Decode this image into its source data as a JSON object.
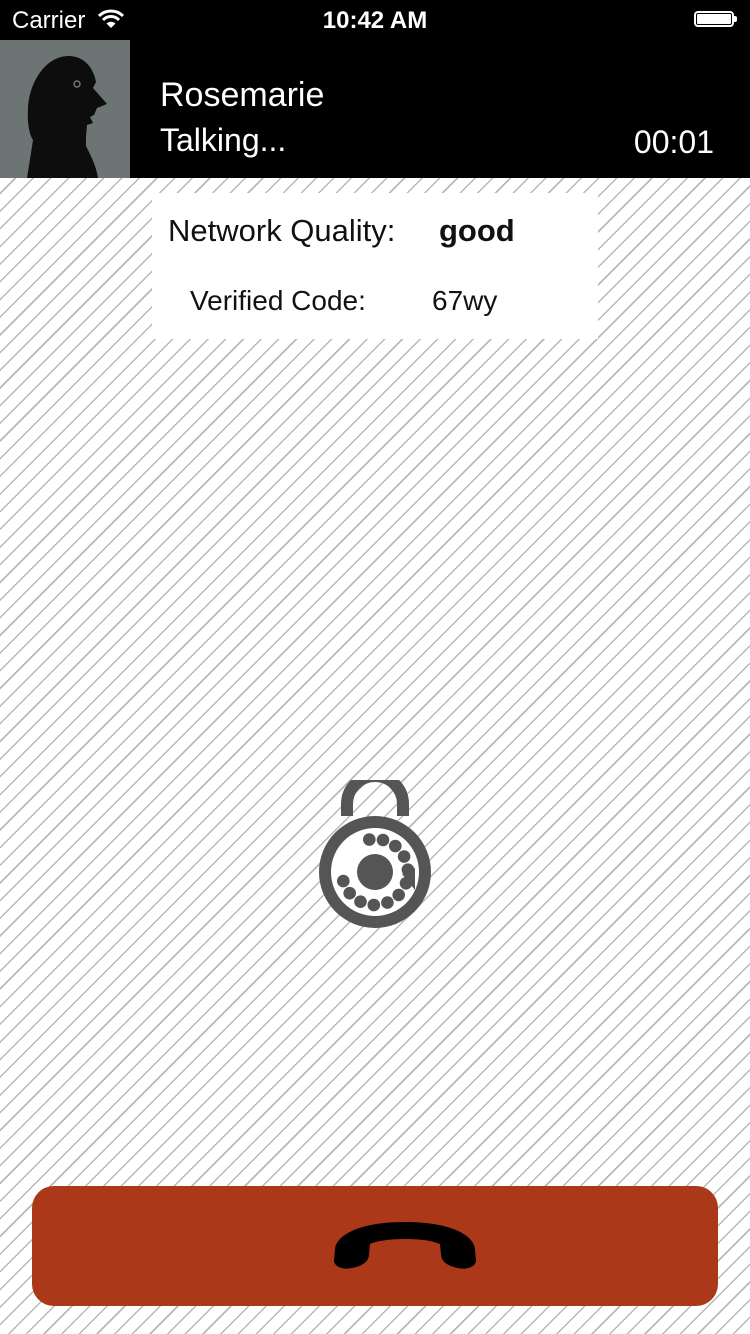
{
  "status_bar": {
    "carrier": "Carrier",
    "time": "10:42 AM",
    "wifi_icon": "wifi-icon",
    "battery_icon": "battery-icon"
  },
  "call": {
    "caller_name": "Rosemarie",
    "status": "Talking...",
    "timer": "00:01",
    "avatar_icon": "person-silhouette-icon"
  },
  "info": {
    "network_quality_label": "Network Quality:",
    "network_quality_value": "good",
    "verified_code_label": "Verified Code:",
    "verified_code_value": "67wy"
  },
  "lock_icon": "combination-lock-icon",
  "hangup": {
    "icon": "phone-hangup-icon",
    "color": "#ab3818"
  },
  "colors": {
    "header_bg": "#000000",
    "avatar_bg": "#6c7574",
    "lock_gray": "#555555"
  }
}
